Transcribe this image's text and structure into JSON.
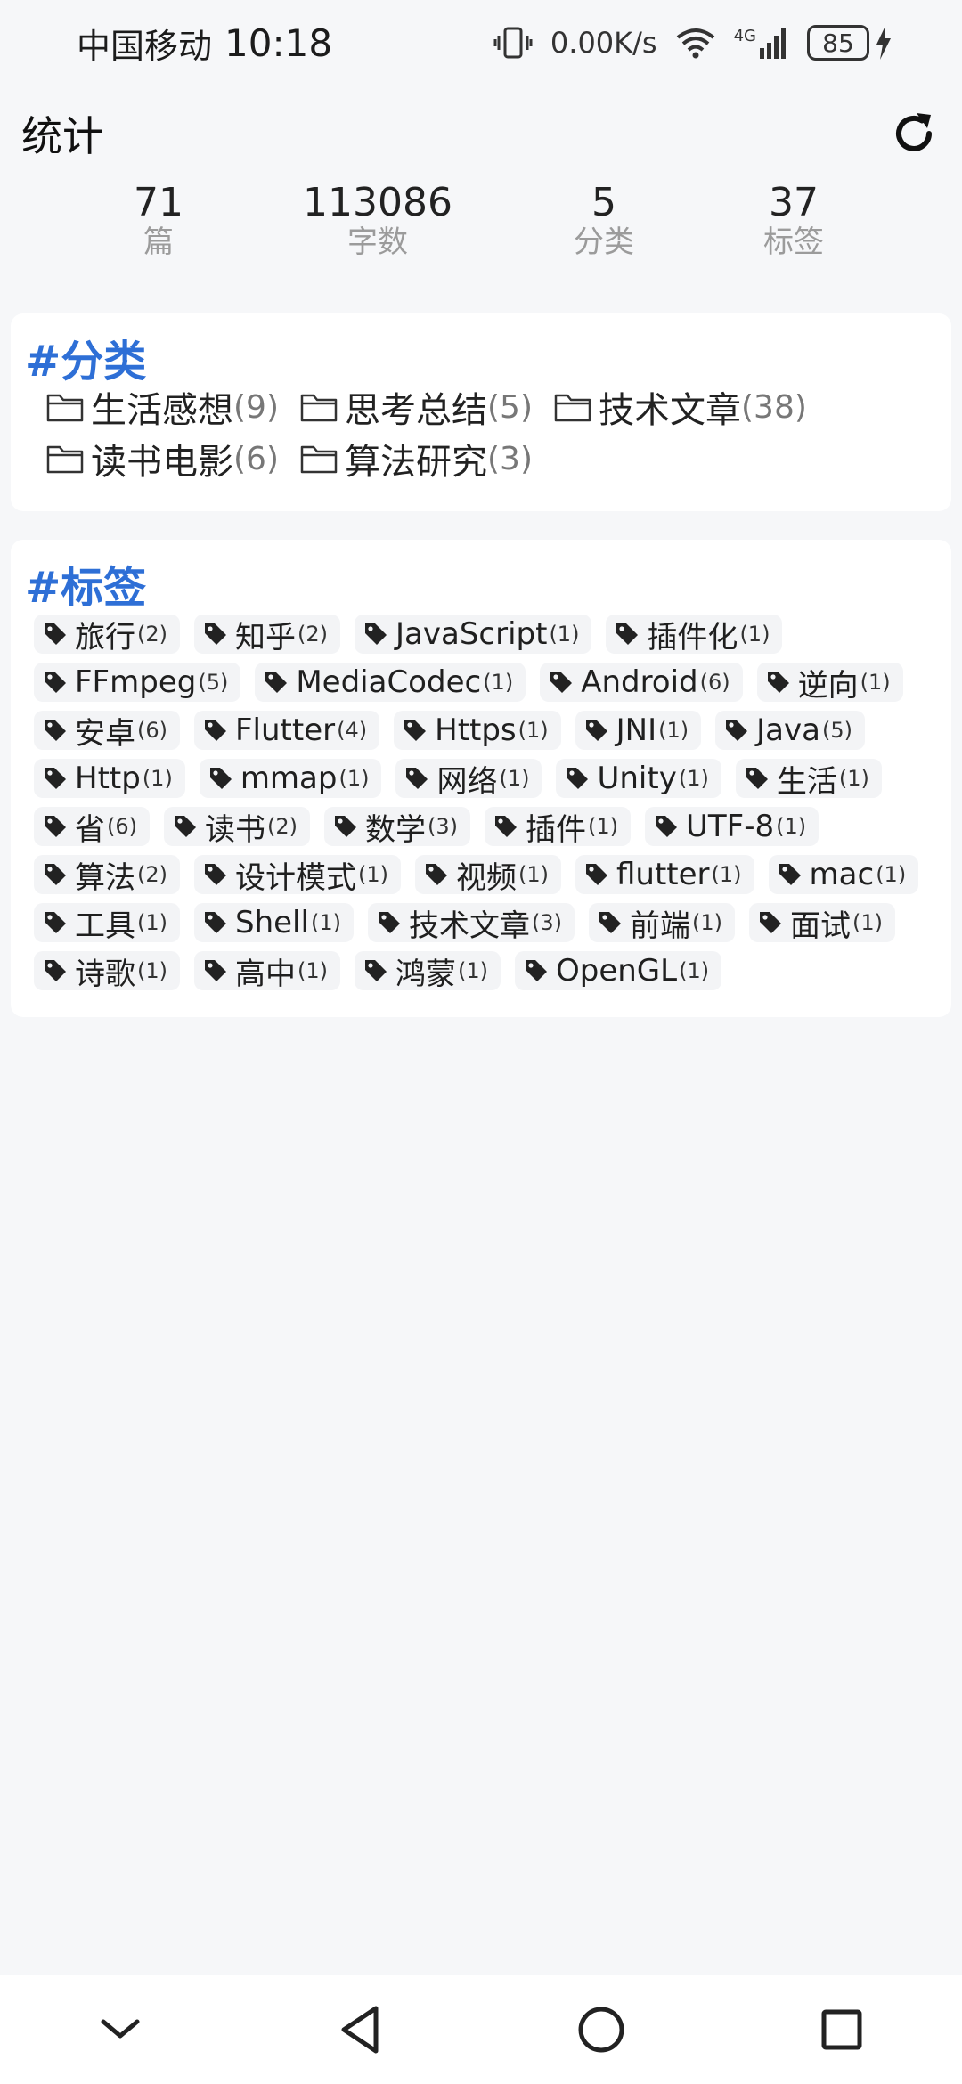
{
  "status_bar": {
    "carrier": "中国移动",
    "time": "10:18",
    "network_speed": "0.00K/s",
    "network_type": "4G",
    "battery": "85"
  },
  "header": {
    "title": "统计"
  },
  "stats": [
    {
      "value": "71",
      "label": "篇"
    },
    {
      "value": "113086",
      "label": "字数"
    },
    {
      "value": "5",
      "label": "分类"
    },
    {
      "value": "37",
      "label": "标签"
    }
  ],
  "categories": {
    "title": "#分类",
    "items": [
      {
        "name": "生活感想",
        "count": "(9)"
      },
      {
        "name": "思考总结",
        "count": "(5)"
      },
      {
        "name": "技术文章",
        "count": "(38)"
      },
      {
        "name": "读书电影",
        "count": "(6)"
      },
      {
        "name": "算法研究",
        "count": "(3)"
      }
    ]
  },
  "tags": {
    "title": "#标签",
    "items": [
      {
        "name": "旅行",
        "count": "(2)"
      },
      {
        "name": "知乎",
        "count": "(2)"
      },
      {
        "name": "JavaScript",
        "count": "(1)"
      },
      {
        "name": "插件化",
        "count": "(1)"
      },
      {
        "name": "FFmpeg",
        "count": "(5)"
      },
      {
        "name": "MediaCodec",
        "count": "(1)"
      },
      {
        "name": "Android",
        "count": "(6)"
      },
      {
        "name": "逆向",
        "count": "(1)"
      },
      {
        "name": "安卓",
        "count": "(6)"
      },
      {
        "name": "Flutter",
        "count": "(4)"
      },
      {
        "name": "Https",
        "count": "(1)"
      },
      {
        "name": "JNI",
        "count": "(1)"
      },
      {
        "name": "Java",
        "count": "(5)"
      },
      {
        "name": "Http",
        "count": "(1)"
      },
      {
        "name": "mmap",
        "count": "(1)"
      },
      {
        "name": "网络",
        "count": "(1)"
      },
      {
        "name": "Unity",
        "count": "(1)"
      },
      {
        "name": "生活",
        "count": "(1)"
      },
      {
        "name": "省",
        "count": "(6)"
      },
      {
        "name": "读书",
        "count": "(2)"
      },
      {
        "name": "数学",
        "count": "(3)"
      },
      {
        "name": "插件",
        "count": "(1)"
      },
      {
        "name": "UTF-8",
        "count": "(1)"
      },
      {
        "name": "算法",
        "count": "(2)"
      },
      {
        "name": "设计模式",
        "count": "(1)"
      },
      {
        "name": "视频",
        "count": "(1)"
      },
      {
        "name": "flutter",
        "count": "(1)"
      },
      {
        "name": "mac",
        "count": "(1)"
      },
      {
        "name": "工具",
        "count": "(1)"
      },
      {
        "name": "Shell",
        "count": "(1)"
      },
      {
        "name": "技术文章",
        "count": "(3)"
      },
      {
        "name": "前端",
        "count": "(1)"
      },
      {
        "name": "面试",
        "count": "(1)"
      },
      {
        "name": "诗歌",
        "count": "(1)"
      },
      {
        "name": "高中",
        "count": "(1)"
      },
      {
        "name": "鸿蒙",
        "count": "(1)"
      },
      {
        "name": "OpenGL",
        "count": "(1)"
      }
    ]
  },
  "icons": {
    "refresh": "refresh-icon",
    "folder": "folder-icon",
    "tag": "tag-icon",
    "nav": [
      "chevron-down-icon",
      "back-icon",
      "home-icon",
      "recents-icon"
    ]
  },
  "colors": {
    "accent": "#2e6fd6",
    "background": "#f6f7f9",
    "card": "#ffffff",
    "chip": "#f3f4f6"
  }
}
